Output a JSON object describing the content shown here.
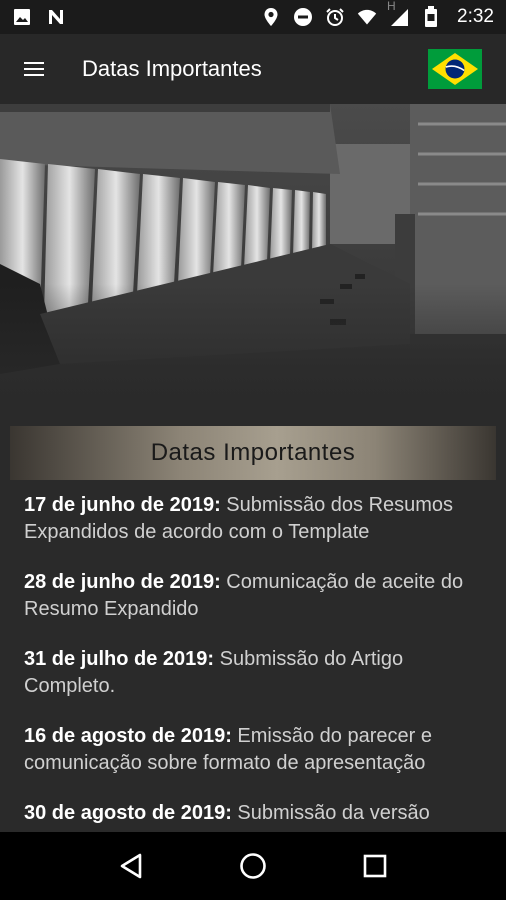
{
  "status_bar": {
    "time": "2:32",
    "left_icons": [
      "image-icon",
      "n-icon"
    ],
    "right_icons": [
      "location-icon",
      "do-not-disturb-icon",
      "alarm-icon",
      "wifi-icon",
      "signal-icon",
      "battery-icon"
    ],
    "network_label": "H"
  },
  "app_bar": {
    "title": "Datas Importantes",
    "menu_icon": "hamburger-menu-icon",
    "language_flag": "brazil-flag-icon"
  },
  "section": {
    "title": "Datas Importantes"
  },
  "dates": [
    {
      "date": "17 de junho de 2019:",
      "text": " Submissão dos Resumos Expandidos de acordo com o Template"
    },
    {
      "date": "28 de junho de 2019:",
      "text": " Comunicação de aceite do Resumo Expandido"
    },
    {
      "date": "31 de julho de 2019:",
      "text": " Submissão do Artigo Completo."
    },
    {
      "date": "16 de agosto de 2019:",
      "text": " Emissão do parecer e comunicação sobre formato de apresentação"
    },
    {
      "date": "30 de agosto de 2019:",
      "text": " Submissão da versão"
    }
  ],
  "nav_bar": {
    "back_icon": "back-triangle-icon",
    "home_icon": "home-circle-icon",
    "recents_icon": "recents-square-icon"
  },
  "colors": {
    "status_bar": "#1b1b1b",
    "app_bar": "#282828",
    "background": "#2a2a2a",
    "header_gold": "#a79f8f",
    "flag_green": "#009c3b",
    "flag_yellow": "#ffdf00",
    "flag_blue": "#002776"
  }
}
